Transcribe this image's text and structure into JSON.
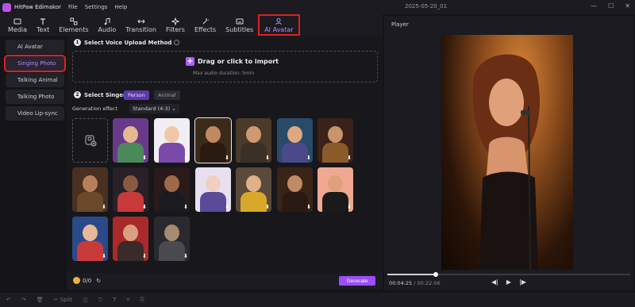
{
  "titlebar": {
    "app_title": "HitPaw Edimakor",
    "menu": [
      "File",
      "Settings",
      "Help"
    ],
    "document": "2025-05-20_01"
  },
  "toolbar": [
    {
      "label": "Media",
      "icon": "media-icon"
    },
    {
      "label": "Text",
      "icon": "text-icon"
    },
    {
      "label": "Elements",
      "icon": "elements-icon"
    },
    {
      "label": "Audio",
      "icon": "audio-icon"
    },
    {
      "label": "Transition",
      "icon": "transition-icon"
    },
    {
      "label": "Filters",
      "icon": "filters-icon"
    },
    {
      "label": "Effects",
      "icon": "effects-icon"
    },
    {
      "label": "Subtitles",
      "icon": "subtitles-icon"
    },
    {
      "label": "AI Avatar",
      "icon": "ai-avatar-icon",
      "active": true
    }
  ],
  "sidebar": [
    {
      "label": "AI Avatar"
    },
    {
      "label": "Singing Photo",
      "active": true
    },
    {
      "label": "Talking Animal"
    },
    {
      "label": "Talking Photo"
    },
    {
      "label": "Video Lip-sync"
    }
  ],
  "step1": {
    "num": "1",
    "title": "Select Voice Upload Method",
    "drop_main": "Drag or click to import",
    "drop_sub": "Max audio duration: 5min"
  },
  "step2": {
    "num": "2",
    "title": "Select Singer",
    "tabs": [
      "Person",
      "Animal"
    ],
    "active_tab": "Person",
    "gen_label": "Generation effect",
    "gen_value": "Standard (4:3)"
  },
  "footer": {
    "credits": "0/0",
    "generate": "Generate"
  },
  "player": {
    "title": "Player",
    "current": "00:04:25",
    "total": "/ 00:22:06",
    "progress": 0.2
  },
  "statusbar": {
    "split": "Split"
  },
  "colors": {
    "accent": "#9b4dff",
    "highlight": "#e02020"
  }
}
